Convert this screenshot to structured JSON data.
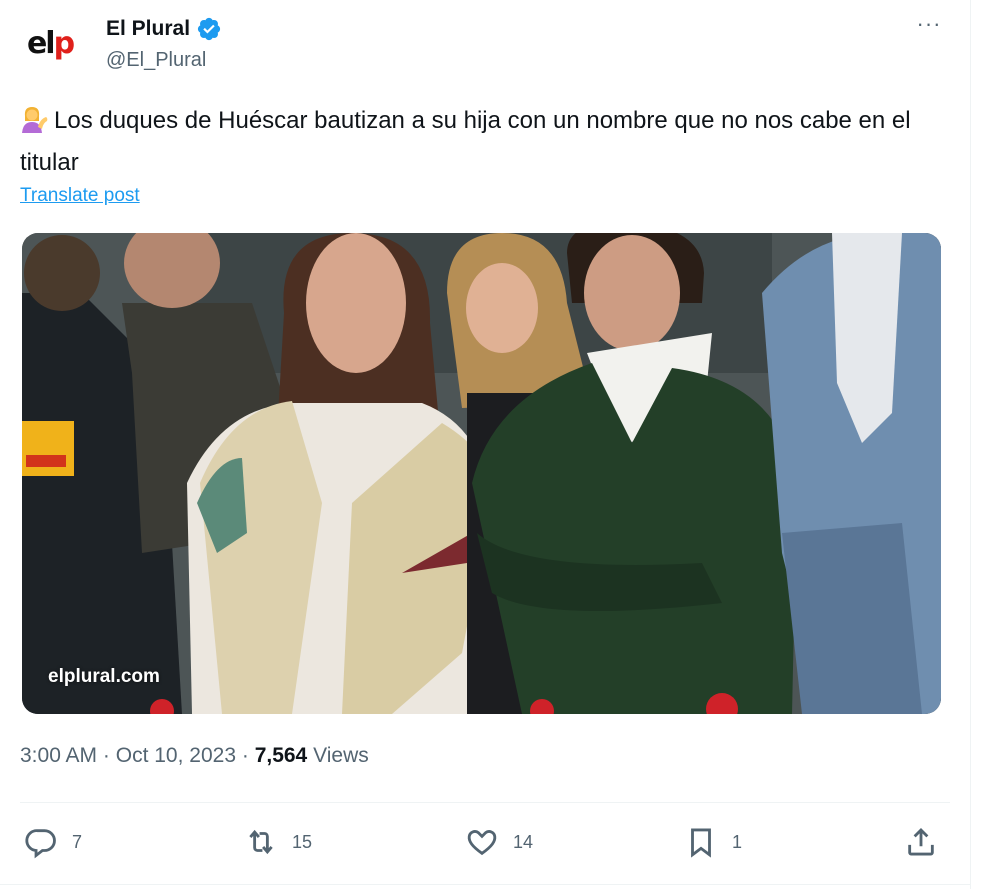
{
  "author": {
    "name": "El Plural",
    "handle": "@El_Plural",
    "avatar_logo_dark": "el",
    "avatar_logo_red": "p",
    "verified_icon": "verified-badge-icon",
    "verified_color": "#1d9bf0"
  },
  "post": {
    "emoji_icon": "woman-tipping-hand-emoji",
    "text": "Los duques de Huéscar bautizan a su hija con un nombre que no nos cabe en el titular",
    "translate_label": "Translate post",
    "image_watermark": "elplural.com",
    "time": "3:00 AM",
    "date": "Oct 10, 2023",
    "dot": "·",
    "views_count": "7,564",
    "views_label": "Views"
  },
  "actions": {
    "replies": "7",
    "reposts": "15",
    "likes": "14",
    "bookmarks": "1"
  },
  "colors": {
    "text": "#0f1419",
    "secondary": "#536471",
    "link": "#1d9bf0",
    "brand_red": "#e0201b"
  }
}
